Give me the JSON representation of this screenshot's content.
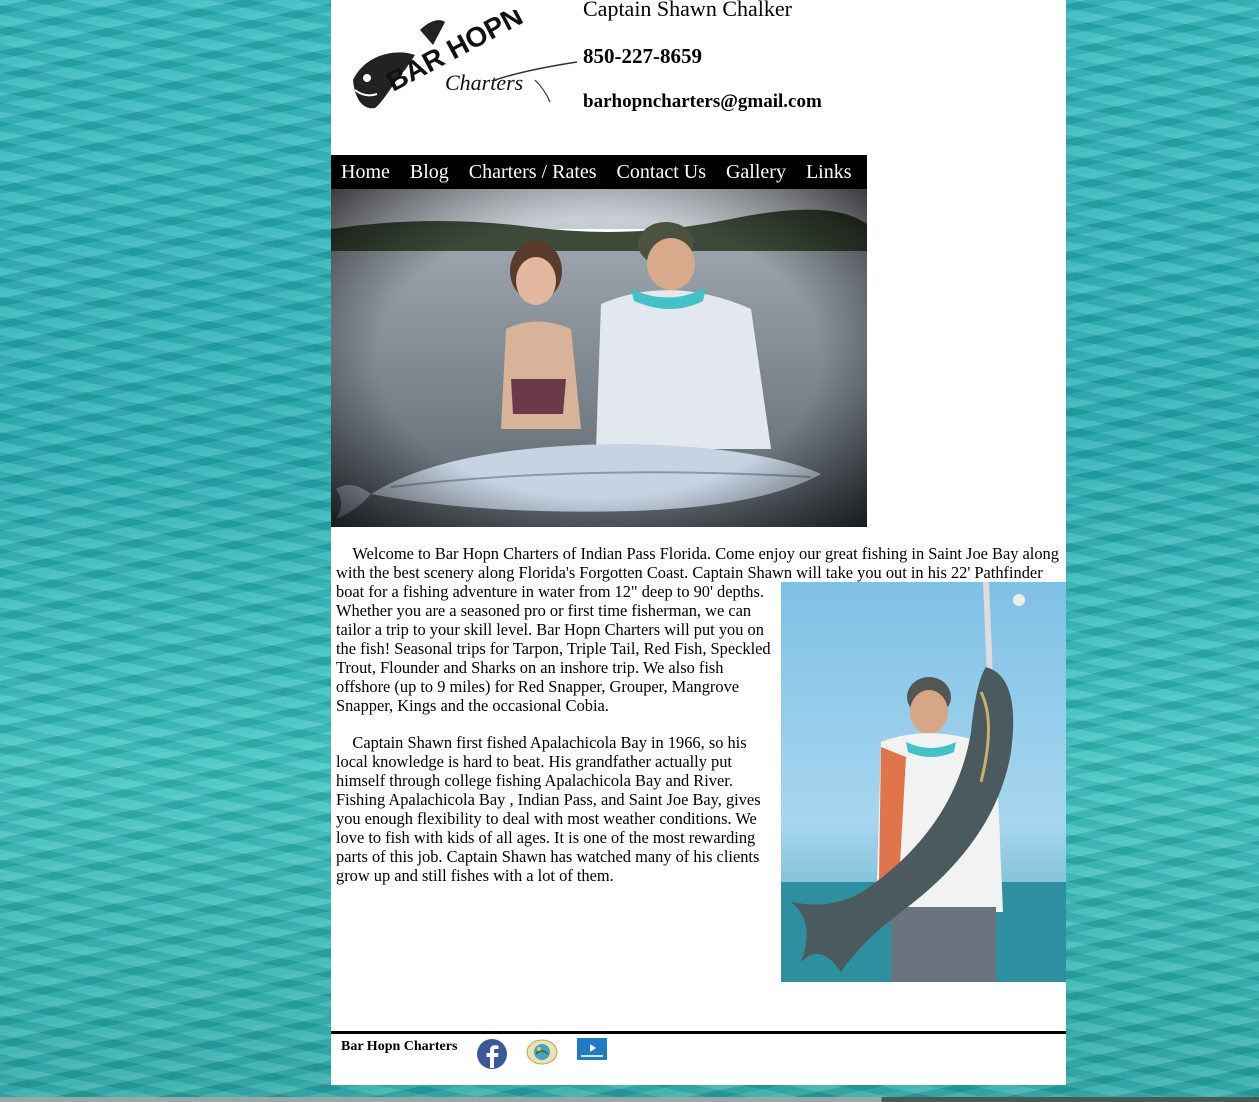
{
  "header": {
    "logo_text_main": "BAR HOPN",
    "logo_text_sub": "Charters",
    "captain_name": "Captain Shawn Chalker",
    "phone": "850-227-8659",
    "email": "barhopncharters@gmail.com"
  },
  "nav": {
    "items": [
      {
        "label": "Home"
      },
      {
        "label": "Blog"
      },
      {
        "label": "Charters / Rates"
      },
      {
        "label": "Contact Us"
      },
      {
        "label": "Gallery"
      },
      {
        "label": "Links"
      }
    ]
  },
  "content": {
    "paragraph1": "Welcome to Bar Hopn Charters of Indian Pass Florida. Come enjoy our great fishing in Saint Joe Bay along with the best scenery along Florida's Forgotten Coast. Captain Shawn will take you out in his 22' Pathfinder boat for a fishing adventure in water from 12\" deep to 90' depths. Whether you are a seasoned pro or first time fisherman, we can tailor a trip to your skill level. Bar Hopn Charters will put you on the fish! Seasonal trips for Tarpon, Triple Tail, Red Fish, Speckled Trout, Flounder and Sharks on an inshore trip. We also fish offshore (up to 9 miles) for Red Snapper, Grouper, Mangrove Snapper, Kings and the occasional Cobia.",
    "paragraph2": "Captain Shawn first fished Apalachicola Bay in 1966, so his local knowledge is hard to beat. His grandfather actually put himself through college fishing Apalachicola Bay and River. Fishing Apalachicola Bay , Indian Pass, and Saint Joe Bay, gives you enough flexibility to deal with most weather conditions. We love to fish with kids of all ages. It is one of the most rewarding parts of this job. Captain Shawn has watched many of his clients grow up and still fishes with a lot of them."
  },
  "footer": {
    "brand": "Bar Hopn Charters",
    "icons": [
      "facebook-icon",
      "fwc-seal-icon",
      "boat-brand-icon"
    ]
  },
  "colors": {
    "nav_bg": "#000000",
    "nav_text": "#ffffff",
    "water": "#2fb9bd",
    "facebook": "#3b5998"
  }
}
